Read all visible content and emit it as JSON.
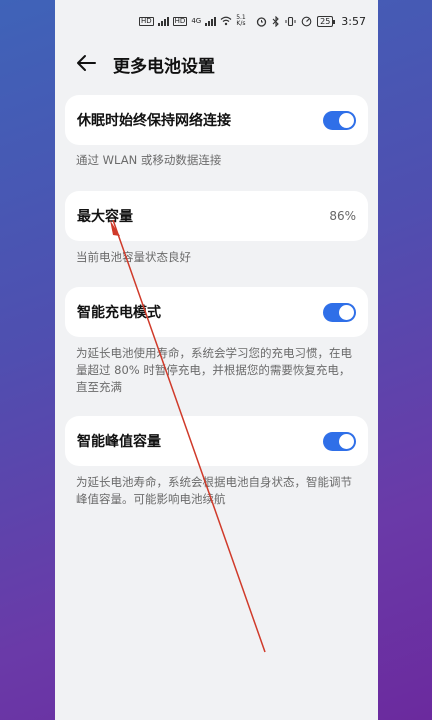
{
  "status_bar": {
    "sim1": "HD",
    "sim2": "HD",
    "network": "4G",
    "speed_value": "5.1",
    "speed_unit": "K/s",
    "battery_level": "25",
    "time": "3:57"
  },
  "header": {
    "title": "更多电池设置"
  },
  "settings": [
    {
      "label": "休眠时始终保持网络连接",
      "toggle_on": true,
      "description": "通过 WLAN 或移动数据连接"
    },
    {
      "label": "最大容量",
      "value": "86%",
      "description": "当前电池容量状态良好"
    },
    {
      "label": "智能充电模式",
      "toggle_on": true,
      "description": "为延长电池使用寿命，系统会学习您的充电习惯，在电量超过 80% 时暂停充电，并根据您的需要恢复充电，直至充满"
    },
    {
      "label": "智能峰值容量",
      "toggle_on": true,
      "description": "为延长电池寿命，系统会根据电池自身状态，智能调节峰值容量。可能影响电池续航"
    }
  ],
  "colors": {
    "accent": "#2f6fe8",
    "annotation": "#d03a2a"
  }
}
